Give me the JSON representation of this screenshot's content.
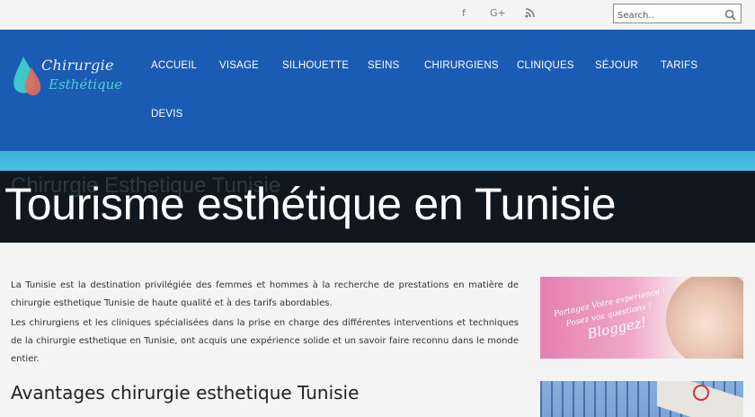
{
  "social": {
    "facebook": "f",
    "google_plus": "G+",
    "rss": "rss-icon"
  },
  "search": {
    "placeholder": "Search.."
  },
  "logo": {
    "line1": "Chirurgie",
    "line2": "Esthétique"
  },
  "nav": [
    "ACCUEIL",
    "VISAGE",
    "SILHOUETTE",
    "SEINS",
    "CHIRURGIENS",
    "CLINIQUES",
    "SÉJOUR",
    "TARIFS",
    "DEVIS"
  ],
  "hero": {
    "background_text": "Chirurgie Esthetique Tunisie",
    "title": "Tourisme esthétique en Tunisie"
  },
  "article": {
    "p1": "La Tunisie est la destination privilégiée des femmes et hommes à la recherche de prestations en matière de chirurgie esthetique Tunisie de haute qualité et à des tarifs abordables.",
    "p2": "Les chirurgiens et les cliniques spécialisées dans la prise en charge des différentes interventions et techniques de la chirurgie esthetique en Tunisie, ont acquis une expérience solide et un savoir faire reconnu dans le monde entier.",
    "heading": "Avantages chirurgie esthetique Tunisie"
  },
  "ad_blog": {
    "line1": "Partagez Votre experience !",
    "line2": "Posez vos questions !",
    "cta": "Bloggez!"
  },
  "colors": {
    "header": "#1a5cb4",
    "strip": "#3fb3d8",
    "hero_bg": "#10181d"
  }
}
